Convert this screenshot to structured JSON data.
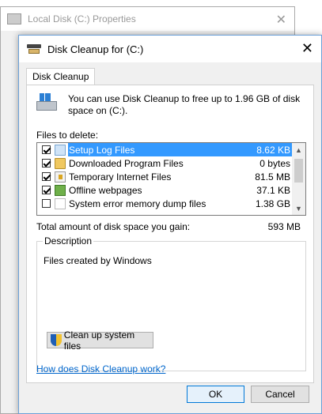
{
  "back_window": {
    "title": "Local Disk (C:) Properties",
    "close": "✕"
  },
  "dialog": {
    "title": "Disk Cleanup for  (C:)",
    "close": "✕"
  },
  "tabs": [
    {
      "label": "Disk Cleanup"
    }
  ],
  "intro": {
    "text": "You can use Disk Cleanup to free up to 1.96 GB of disk space on  (C:)."
  },
  "files_label": "Files to delete:",
  "files": [
    {
      "name": "Setup Log Files",
      "size": "8.62 KB",
      "checked": true,
      "selected": true,
      "icon": "document-icon"
    },
    {
      "name": "Downloaded Program Files",
      "size": "0 bytes",
      "checked": true,
      "selected": false,
      "icon": "folder-icon"
    },
    {
      "name": "Temporary Internet Files",
      "size": "81.5 MB",
      "checked": true,
      "selected": false,
      "icon": "lock-icon"
    },
    {
      "name": "Offline webpages",
      "size": "37.1 KB",
      "checked": true,
      "selected": false,
      "icon": "offline-icon"
    },
    {
      "name": "System error memory dump files",
      "size": "1.38 GB",
      "checked": false,
      "selected": false,
      "icon": "blank-file-icon"
    }
  ],
  "total": {
    "label": "Total amount of disk space you gain:",
    "value": "593 MB"
  },
  "description": {
    "legend": "Description",
    "text": "Files created by Windows"
  },
  "cleanup_button": "Clean up system files",
  "help_link": "How does Disk Cleanup work?",
  "buttons": {
    "ok": "OK",
    "cancel": "Cancel"
  },
  "colors": {
    "selection": "#3399ff",
    "link": "#0066cc",
    "default_button_border": "#0078d7"
  }
}
